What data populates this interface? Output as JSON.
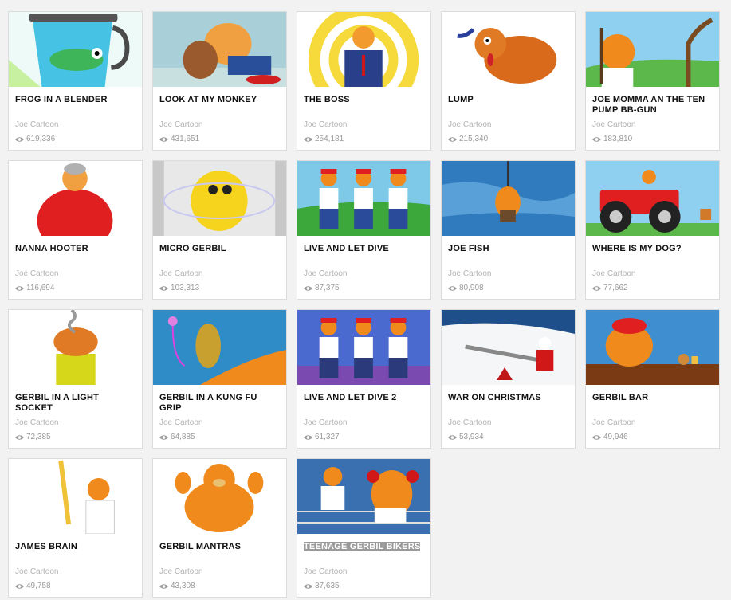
{
  "cards": [
    {
      "title": "FROG IN A BLENDER",
      "author": "Joe Cartoon",
      "views": "619,336",
      "icon": "frog-blender-thumbnail",
      "bg": "#e6f7f5"
    },
    {
      "title": "LOOK AT MY MONKEY",
      "author": "Joe Cartoon",
      "views": "431,651",
      "icon": "monkey-thumbnail",
      "bg": "#a9d0d8"
    },
    {
      "title": "THE BOSS",
      "author": "Joe Cartoon",
      "views": "254,181",
      "icon": "boss-thumbnail",
      "bg": "#f7d94a"
    },
    {
      "title": "LUMP",
      "author": "Joe Cartoon",
      "views": "215,340",
      "icon": "lump-dog-thumbnail",
      "bg": "#ffffff"
    },
    {
      "title": "JOE MOMMA AN THE TEN PUMP BB-GUN",
      "author": "Joe Cartoon",
      "views": "183,810",
      "icon": "bb-gun-thumbnail",
      "bg": "#8fd0f0"
    },
    {
      "title": "NANNA HOOTER",
      "author": "Joe Cartoon",
      "views": "116,694",
      "icon": "nanna-thumbnail",
      "bg": "#ffffff"
    },
    {
      "title": "MICRO GERBIL",
      "author": "Joe Cartoon",
      "views": "103,313",
      "icon": "micro-gerbil-thumbnail",
      "bg": "#e8e8e8"
    },
    {
      "title": "LIVE AND LET DIVE",
      "author": "Joe Cartoon",
      "views": "87,375",
      "icon": "judges-thumbnail",
      "bg": "#7ec8e8"
    },
    {
      "title": "JOE FISH",
      "author": "Joe Cartoon",
      "views": "80,908",
      "icon": "joe-fish-thumbnail",
      "bg": "#2f7bbd"
    },
    {
      "title": "WHERE IS MY DOG?",
      "author": "Joe Cartoon",
      "views": "77,662",
      "icon": "monster-truck-thumbnail",
      "bg": "#8fd0f0"
    },
    {
      "title": "GERBIL IN A LIGHT SOCKET",
      "author": "Joe Cartoon",
      "views": "72,385",
      "icon": "light-socket-thumbnail",
      "bg": "#ffffff"
    },
    {
      "title": "GERBIL IN A KUNG FU GRIP",
      "author": "Joe Cartoon",
      "views": "64,885",
      "icon": "kung-fu-grip-thumbnail",
      "bg": "#2f8cc7"
    },
    {
      "title": "LIVE AND LET DIVE 2",
      "author": "Joe Cartoon",
      "views": "61,327",
      "icon": "judges-2-thumbnail",
      "bg": "#4a6ad0"
    },
    {
      "title": "WAR ON CHRISTMAS",
      "author": "Joe Cartoon",
      "views": "53,934",
      "icon": "christmas-thumbnail",
      "bg": "#1f4f8a"
    },
    {
      "title": "GERBIL BAR",
      "author": "Joe Cartoon",
      "views": "49,946",
      "icon": "gerbil-bar-thumbnail",
      "bg": "#3f8fd0"
    },
    {
      "title": "JAMES BRAIN",
      "author": "Joe Cartoon",
      "views": "49,758",
      "icon": "james-brain-thumbnail",
      "bg": "#ffffff"
    },
    {
      "title": "GERBIL MANTRAS",
      "author": "Joe Cartoon",
      "views": "43,308",
      "icon": "gerbil-mantras-thumbnail",
      "bg": "#ffffff"
    },
    {
      "title": "TEENAGE GERBIL BIKERS",
      "author": "Joe Cartoon",
      "views": "37,635",
      "icon": "bikers-thumbnail",
      "bg": "#3a6fb0",
      "selected": true
    }
  ],
  "colors": {
    "accent_orange": "#f08a1c",
    "title": "#111111",
    "meta": "#b3b3b3"
  }
}
